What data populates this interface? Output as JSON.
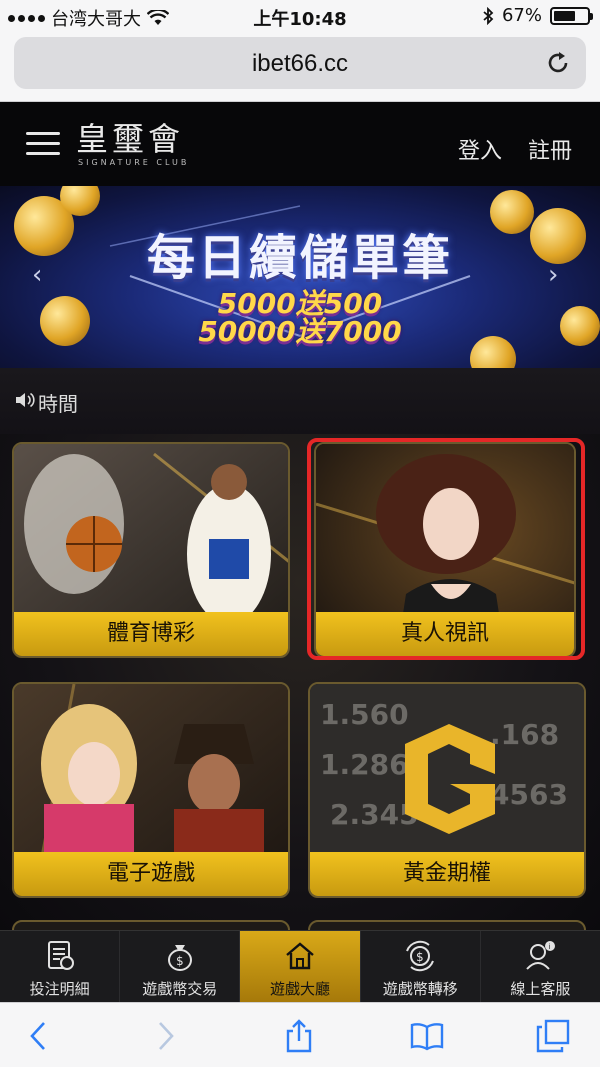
{
  "status_bar": {
    "carrier": "台湾大哥大",
    "time": "上午10:48",
    "battery_percent": "67%",
    "battery_level": 0.67
  },
  "browser": {
    "url": "ibet66.cc"
  },
  "header": {
    "logo_main": "皇璽會",
    "logo_sub": "SIGNATURE CLUB",
    "login": "登入",
    "register": "註冊"
  },
  "banner": {
    "title": "每日續儲單筆",
    "line1": "5000送500",
    "line2": "50000送7000"
  },
  "marquee": {
    "text": "時間"
  },
  "games": [
    {
      "label": "體育博彩",
      "highlighted": false
    },
    {
      "label": "真人視訊",
      "highlighted": true
    },
    {
      "label": "電子遊戲",
      "highlighted": false
    },
    {
      "label": "黃金期權",
      "highlighted": false
    }
  ],
  "bottom_nav": [
    {
      "label": "投注明細",
      "icon": "receipt-icon",
      "active": false
    },
    {
      "label": "遊戲幣交易",
      "icon": "money-bag-icon",
      "active": false
    },
    {
      "label": "遊戲大廳",
      "icon": "home-icon",
      "active": true
    },
    {
      "label": "遊戲幣轉移",
      "icon": "transfer-icon",
      "active": false
    },
    {
      "label": "線上客服",
      "icon": "support-agent-icon",
      "active": false
    }
  ],
  "colors": {
    "accent_gold": "#f1c21e",
    "highlight_red": "#e52727",
    "header_bg": "#070709"
  }
}
